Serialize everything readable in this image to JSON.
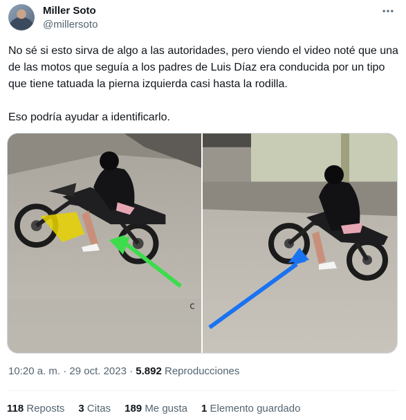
{
  "author": {
    "display_name": "Miller Soto",
    "handle": "@millersoto"
  },
  "tweet": {
    "paragraph_1": "No sé si esto sirva de algo a las autoridades, pero viendo el video noté que una de las motos que seguía a los padres de Luis Díaz era conducida por un tipo que tiene tatuada la pierna izquierda casi hasta la rodilla.",
    "paragraph_2": "Eso podría ayudar a identificarlo."
  },
  "meta": {
    "timestamp": "10:20 a. m. · 29 oct. 2023 ·",
    "views_count": "5.892",
    "views_label": "Reproducciones"
  },
  "stats": {
    "reposts_count": "118",
    "reposts_label": "Reposts",
    "quotes_count": "3",
    "quotes_label": "Citas",
    "likes_count": "189",
    "likes_label": "Me gusta",
    "bookmarks_count": "1",
    "bookmarks_label": "Elemento guardado"
  },
  "icons": {
    "more": "more-horizontal-icon"
  },
  "colors": {
    "text": "#0f1419",
    "secondary": "#536471",
    "divider": "#eff3f4",
    "arrow_green": "#3ddc4c",
    "arrow_blue": "#1a73f0",
    "tattoo_highlight": "#e6d200"
  }
}
